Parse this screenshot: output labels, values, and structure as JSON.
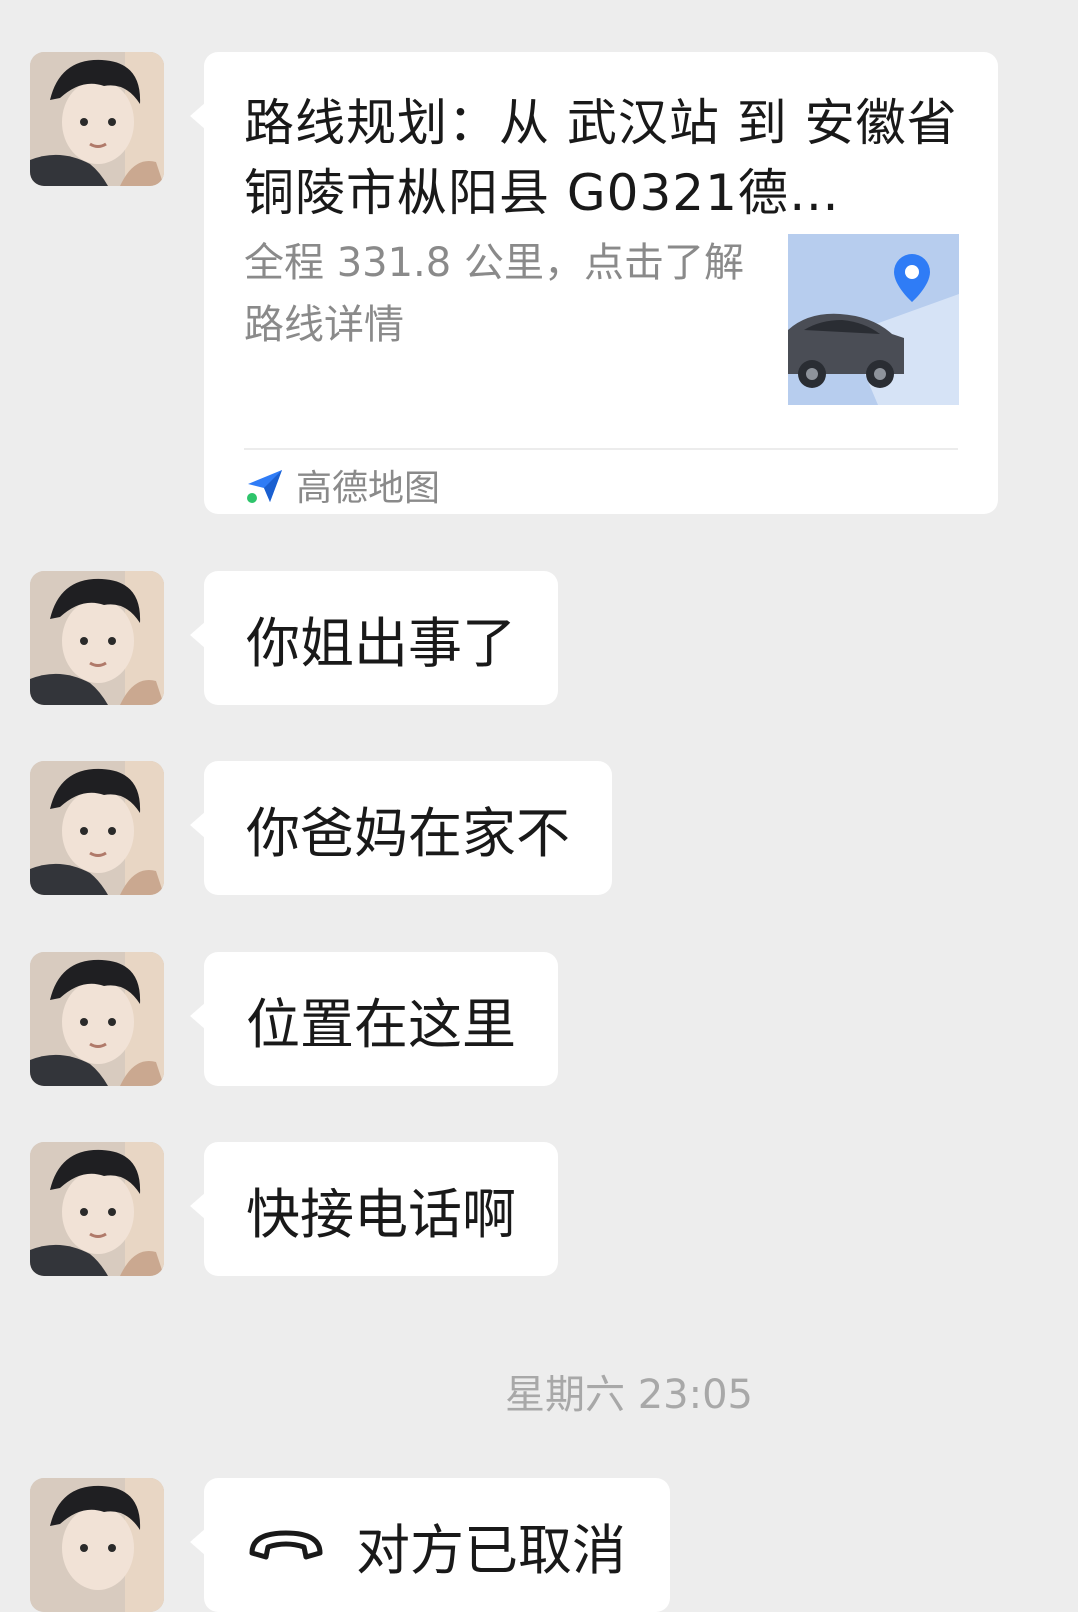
{
  "location_card": {
    "title": "路线规划：从 武汉站 到 安徽省铜陵市枞阳县 G0321德…",
    "description": "全程 331.8 公里，点击了解路线详情",
    "source": "高德地图"
  },
  "messages": [
    {
      "text": "你姐出事了"
    },
    {
      "text": "你爸妈在家不"
    },
    {
      "text": "位置在这里"
    },
    {
      "text": "快接电话啊"
    }
  ],
  "timestamp": "星期六 23:05",
  "call": {
    "status": "对方已取消"
  },
  "colors": {
    "background": "#ededed",
    "bubble": "#ffffff",
    "text": "#191919",
    "muted": "#8a8a8a",
    "map_logo": "#2f7cf6"
  }
}
